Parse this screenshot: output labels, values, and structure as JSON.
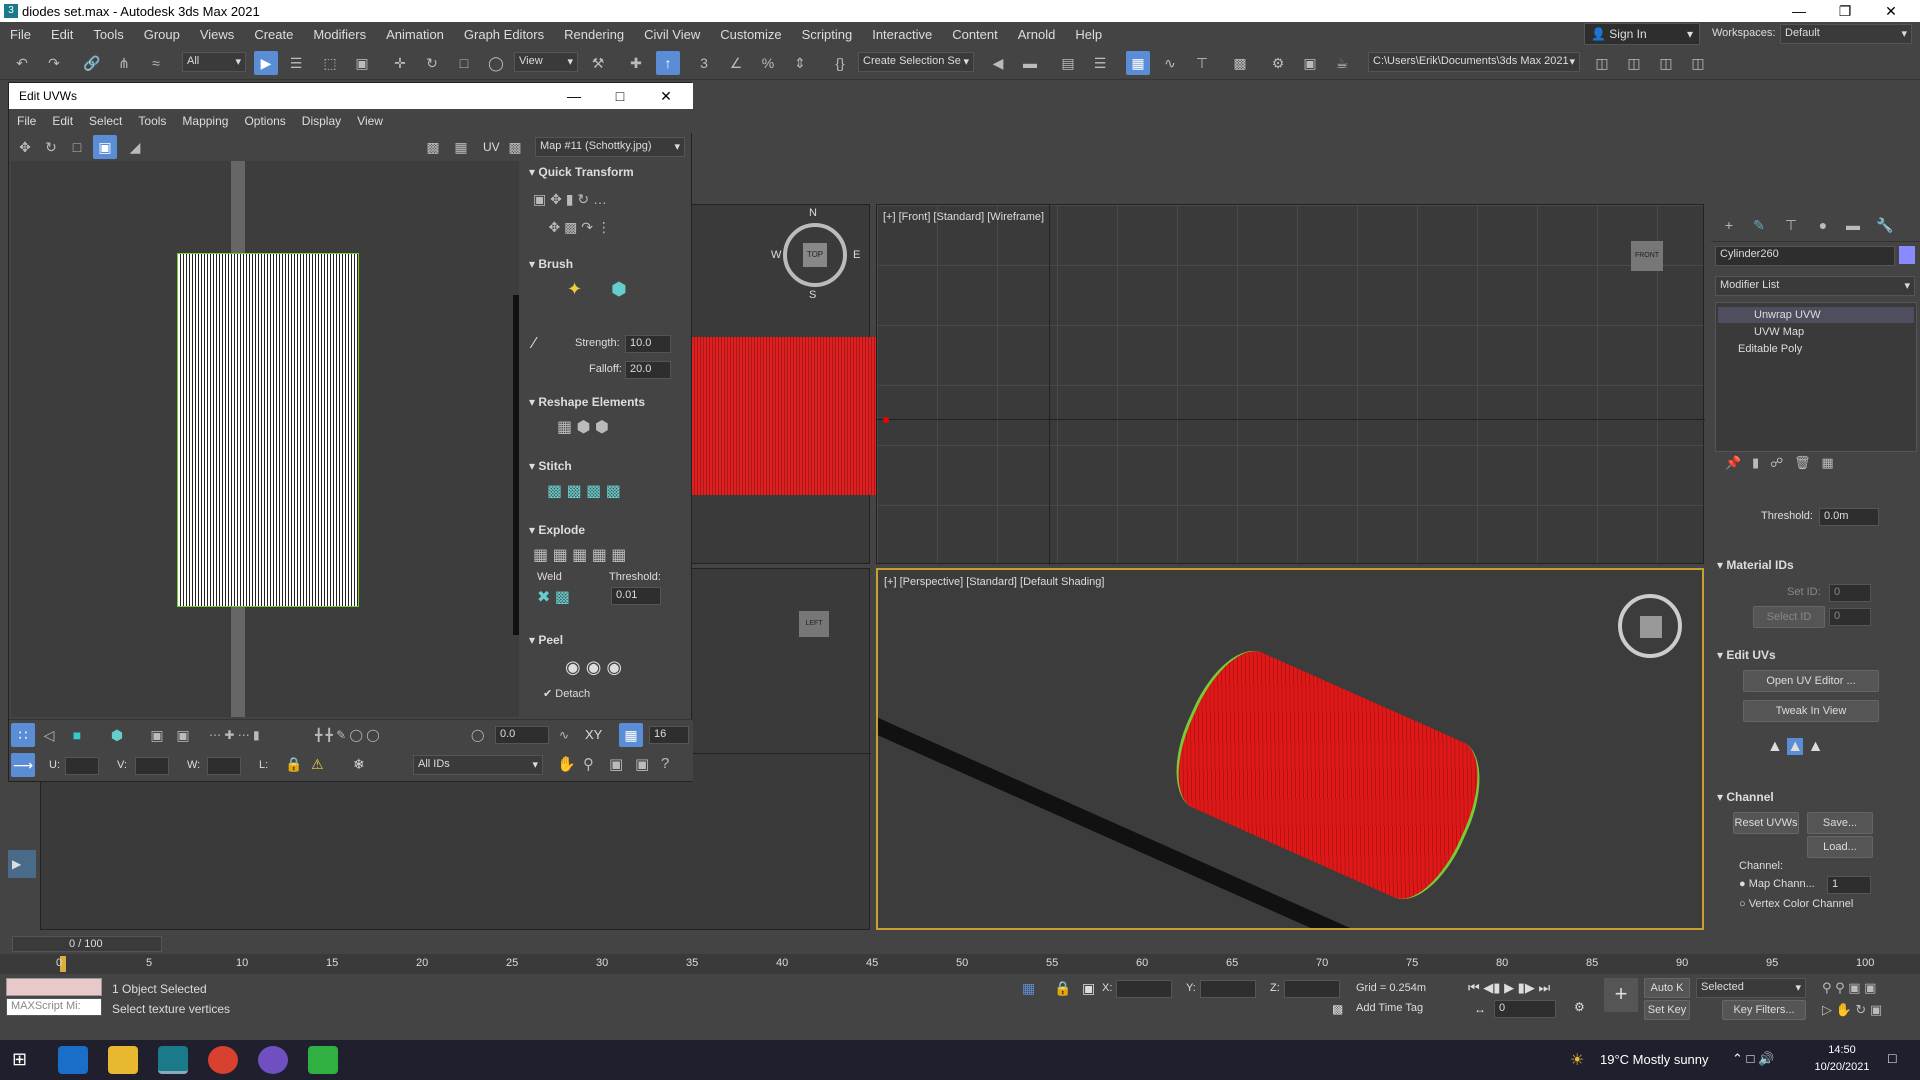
{
  "titlebar": {
    "title": "diodes set.max - Autodesk 3ds Max 2021",
    "app_icon": "3"
  },
  "menubar": [
    "File",
    "Edit",
    "Tools",
    "Group",
    "Views",
    "Create",
    "Modifiers",
    "Animation",
    "Graph Editors",
    "Rendering",
    "Civil View",
    "Customize",
    "Scripting",
    "Interactive",
    "Content",
    "Arnold",
    "Help"
  ],
  "account": {
    "sign_in": "Sign In",
    "workspaces_label": "Workspaces:",
    "workspace": "Default"
  },
  "toolbar": {
    "filter": "All",
    "ref_coord": "View",
    "selection_set": "Create Selection Se",
    "path": "C:\\Users\\Erik\\Documents\\3ds Max 2021"
  },
  "uvw": {
    "title": "Edit UVWs",
    "menu": [
      "File",
      "Edit",
      "Select",
      "Tools",
      "Mapping",
      "Options",
      "Display",
      "View"
    ],
    "uv_label": "UV",
    "map": "Map #11 (Schottky.jpg)",
    "quick_transform": "Quick Transform",
    "brush": "Brush",
    "strength_label": "Strength:",
    "strength": "10.0",
    "falloff_label": "Falloff:",
    "falloff": "20.0",
    "reshape": "Reshape Elements",
    "stitch": "Stitch",
    "explode": "Explode",
    "weld": "Weld",
    "threshold_label": "Threshold:",
    "threshold": "0.01",
    "peel": "Peel",
    "detach": "Detach",
    "angle": "0.0",
    "xy": "XY",
    "snap_val": "16",
    "u_label": "U:",
    "v_label": "V:",
    "w_label": "W:",
    "l_label": "L:",
    "ids": "All IDs"
  },
  "viewports": {
    "front": "[+] [Front] [Standard] [Wireframe]",
    "persp": "[+] [Perspective] [Standard] [Default Shading]",
    "compass": {
      "n": "N",
      "s": "S",
      "e": "E",
      "w": "W",
      "top": "TOP"
    },
    "left_cube": "LEFT",
    "front_cube": "FRONT"
  },
  "cmd": {
    "object_name": "Cylinder260",
    "modifier_list": "Modifier List",
    "stack": [
      "Unwrap UVW",
      "UVW Map",
      "Editable Poly"
    ],
    "threshold_label": "Threshold:",
    "threshold": "0.0m",
    "material_ids": "Material IDs",
    "set_id": "Set ID:",
    "set_id_val": "0",
    "select_id": "Select ID",
    "select_id_val": "0",
    "edit_uvs": "Edit UVs",
    "open_uv_editor": "Open UV Editor ...",
    "tweak": "Tweak In View",
    "channel": "Channel",
    "reset_uvws": "Reset UVWs",
    "save": "Save...",
    "load": "Load...",
    "channel_label": "Channel:",
    "map_channel": "Map Chann...",
    "map_channel_val": "1",
    "vertex_color": "Vertex Color Channel"
  },
  "timeline": {
    "frame": "0 / 100",
    "ticks": [
      "0",
      "5",
      "10",
      "15",
      "20",
      "25",
      "30",
      "35",
      "40",
      "45",
      "50",
      "55",
      "60",
      "65",
      "70",
      "75",
      "80",
      "85",
      "90",
      "95",
      "100"
    ]
  },
  "status": {
    "maxscript": "MAXScript Mi:",
    "objects": "1 Object Selected",
    "prompt": "Select texture vertices",
    "x": "X:",
    "y": "Y:",
    "z": "Z:",
    "grid": "Grid = 0.254m",
    "add_time_tag": "Add Time Tag",
    "auto_key": "Auto K",
    "selected": "Selected",
    "set_key": "Set Key",
    "key_filters": "Key Filters...",
    "frame": "0"
  },
  "taskbar": {
    "weather": "19°C  Mostly sunny",
    "time": "14:50",
    "date": "10/20/2021"
  }
}
